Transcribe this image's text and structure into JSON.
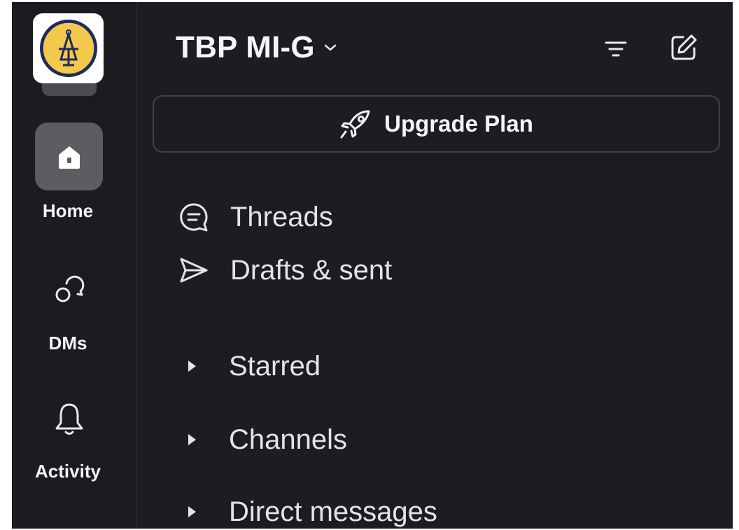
{
  "workspace": {
    "name": "TBP MI-G"
  },
  "upgrade": {
    "label": "Upgrade Plan"
  },
  "rail": {
    "home_label": "Home",
    "dms_label": "DMs",
    "activity_label": "Activity"
  },
  "nav": {
    "threads": "Threads",
    "drafts": "Drafts & sent"
  },
  "sections": {
    "starred": "Starred",
    "channels": "Channels",
    "direct_messages": "Direct messages"
  },
  "icons": {
    "workspace_logo": "tau-beta-pi-bent-icon",
    "home": "house-icon",
    "dms": "chat-bubbles-icon",
    "activity": "bell-icon",
    "filter": "filter-icon",
    "compose": "compose-icon",
    "rocket": "rocket-icon",
    "threads": "thread-icon",
    "drafts": "send-icon",
    "caret": "caret-right-icon"
  },
  "colors": {
    "background": "#1b1d21",
    "rail": "#1a1c20",
    "home_tile": "#5b5d62",
    "logo_gold": "#f2c94c",
    "logo_navy": "#1f2a5a",
    "text": "#e3e4e6"
  }
}
